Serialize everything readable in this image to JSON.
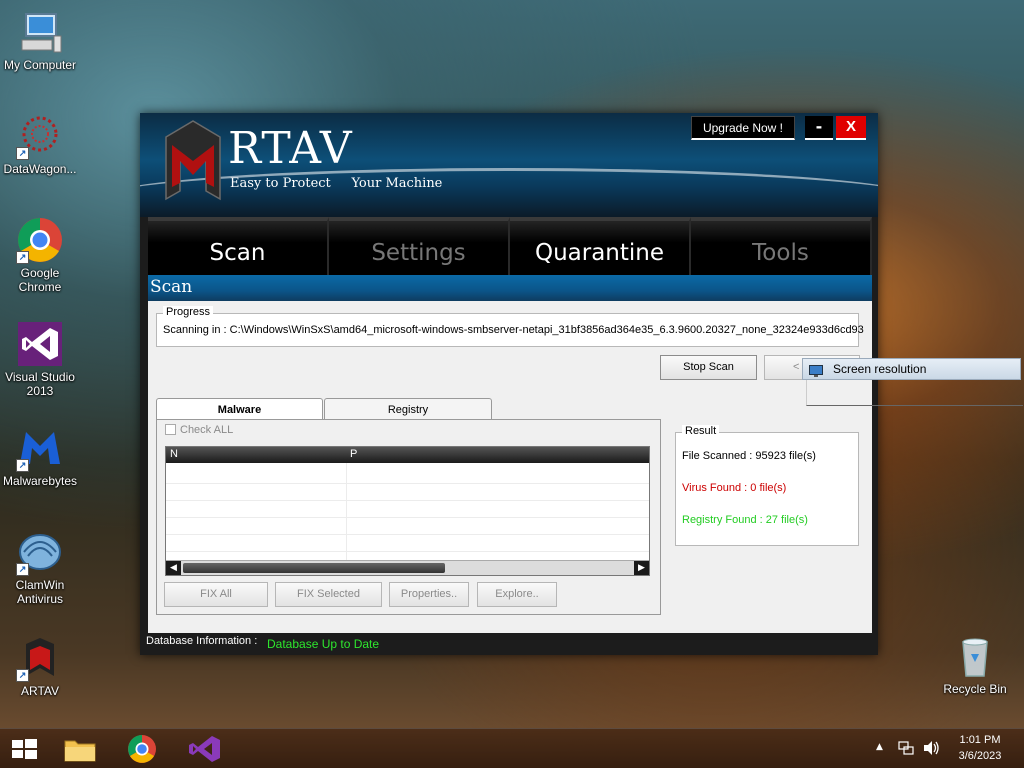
{
  "desktop": {
    "icons": [
      {
        "label": "My Computer"
      },
      {
        "label": "DataWagon..."
      },
      {
        "label": "Google Chrome"
      },
      {
        "label": "Visual Studio 2013"
      },
      {
        "label": "Malwarebytes"
      },
      {
        "label": "ClamWin Antivirus"
      },
      {
        "label": "ARTAV"
      },
      {
        "label": "Recycle Bin"
      }
    ]
  },
  "app": {
    "brand": "RTAV",
    "tagline": "Easy to Protect     Your Machine",
    "upgrade_label": "Upgrade Now !",
    "minimize_label": "-",
    "close_label": "X",
    "nav": [
      {
        "label": "Scan",
        "active": true
      },
      {
        "label": "Settings",
        "active": false
      },
      {
        "label": "Quarantine",
        "active": true
      },
      {
        "label": "Tools",
        "active": false
      }
    ],
    "section_title": "Scan",
    "progress": {
      "legend": "Progress",
      "text": "Scanning in : C:\\Windows\\WinSxS\\amd64_microsoft-windows-smbserver-netapi_31bf3856ad364e35_6.3.9600.20327_none_32324e933d6cd93"
    },
    "stop_scan_label": "Stop Scan",
    "second_button_label": "<",
    "tabs": [
      {
        "label": "Malware"
      },
      {
        "label": "Registry"
      }
    ],
    "check_all_label": "Check ALL",
    "list_columns": [
      "N",
      "P"
    ],
    "actions": {
      "fix_all": "FIX All",
      "fix_selected": "FIX Selected",
      "properties": "Properties..",
      "explore": "Explore.."
    },
    "result": {
      "legend": "Result",
      "files_scanned": "File Scanned : 95923 file(s)",
      "virus_found": "Virus Found : 0 file(s)",
      "registry_found": "Registry Found : 27 file(s)"
    },
    "status": {
      "label": "Database Information :",
      "value": "Database Up to Date"
    },
    "colors": {
      "virus": "#cc0000",
      "registry": "#22cc22",
      "status_value": "#2ee62e",
      "close": "#e00000"
    }
  },
  "tooltip": {
    "label": "Screen resolution"
  },
  "taskbar": {
    "time": "1:01 PM",
    "date": "3/6/2023"
  }
}
